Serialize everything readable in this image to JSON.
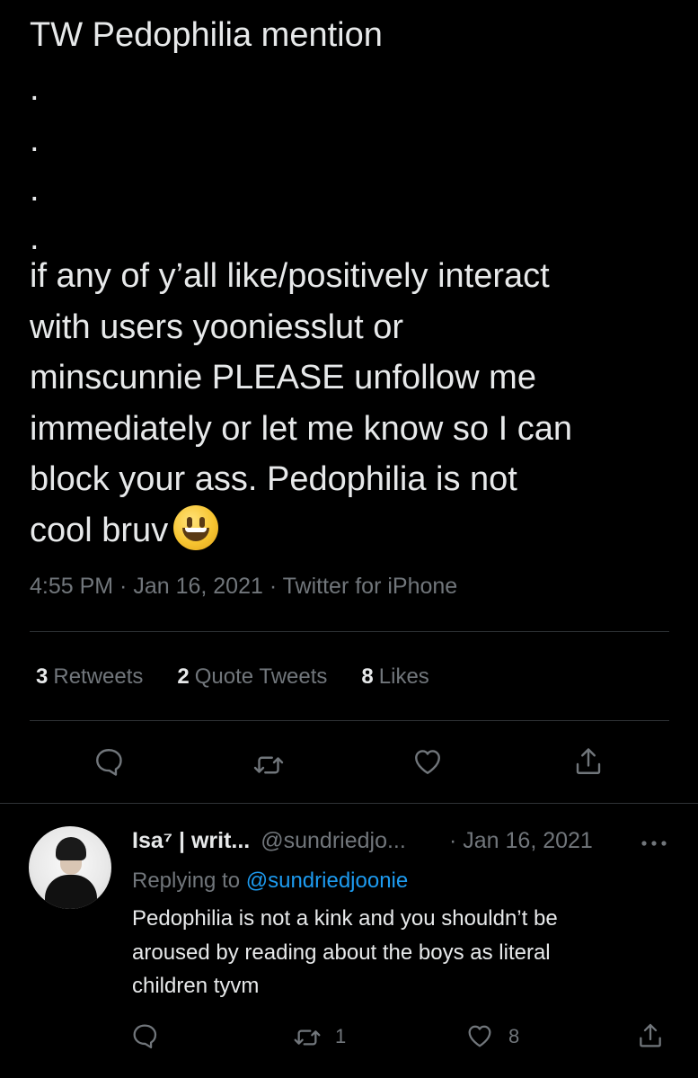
{
  "tweet": {
    "header": "TW Pedophilia mention",
    "dots": [
      ".",
      ".",
      ".",
      "."
    ],
    "body_lines": [
      "if any of y’all like/positively interact",
      "with users yooniesslut or",
      "minscunnie PLEASE unfollow me",
      "immediately or let me know so I can",
      "block your ass. Pedophilia is not",
      "cool bruv"
    ],
    "emoji": "grinning-face",
    "meta": "4:55 PM · Jan 16, 2021 · Twitter for iPhone"
  },
  "stats": {
    "retweets_count": "3",
    "retweets_label": "Retweets",
    "quotes_count": "2",
    "quotes_label": "Quote Tweets",
    "likes_count": "8",
    "likes_label": "Likes"
  },
  "actions": [
    "reply-icon",
    "retweet-icon",
    "like-icon",
    "share-icon"
  ],
  "reply": {
    "name": "Isa⁷ | writ...",
    "handle": "@sundriedjo...",
    "date": "· Jan 16, 2021",
    "replying_prefix": "Replying to",
    "replying_to": "@sundriedjoonie",
    "text_lines": [
      "Pedophilia is not a kink and you shouldn’t be",
      "aroused by reading about the boys as literal",
      "children tyvm"
    ],
    "retweet_count": "1",
    "like_count": "8"
  },
  "colors": {
    "background": "#000000",
    "text": "#e7e9ea",
    "secondary": "#71767b",
    "link": "#1d9bf0",
    "divider": "#2f3336"
  }
}
